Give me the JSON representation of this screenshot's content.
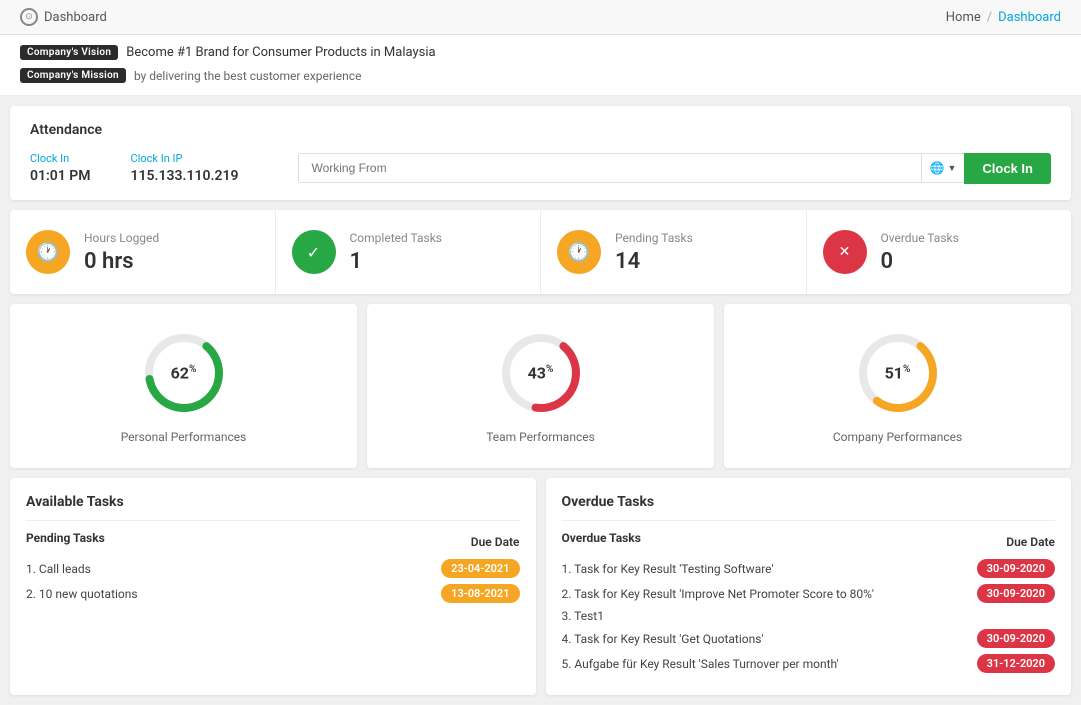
{
  "topbar": {
    "title": "Dashboard",
    "home_label": "Home",
    "separator": "/",
    "current_label": "Dashboard"
  },
  "banner": {
    "vision_badge": "Company's Vision",
    "vision_text": "Become #1 Brand for Consumer Products in Malaysia",
    "mission_badge": "Company's Mission",
    "mission_text": "by delivering the best customer experience"
  },
  "attendance": {
    "title": "Attendance",
    "clock_in_label": "Clock In",
    "clock_in_value": "01:01 PM",
    "clock_in_ip_label": "Clock In IP",
    "clock_in_ip_value": "115.133.110.219",
    "working_from_placeholder": "Working From",
    "clock_in_btn": "Clock In"
  },
  "stats": [
    {
      "icon": "clock",
      "icon_class": "yellow",
      "label": "Hours Logged",
      "count": "0 hrs"
    },
    {
      "icon": "check",
      "icon_class": "green",
      "label": "Completed Tasks",
      "count": "1"
    },
    {
      "icon": "clock",
      "icon_class": "yellow2",
      "label": "Pending Tasks",
      "count": "14"
    },
    {
      "icon": "x",
      "icon_class": "red",
      "label": "Overdue Tasks",
      "count": "0"
    }
  ],
  "performances": [
    {
      "label": "Personal Performances",
      "percent": 62,
      "color_start": "#28a745",
      "color_end": "#28a745",
      "bg": "#e8e8e8",
      "text_color": "#28a745"
    },
    {
      "label": "Team Performances",
      "percent": 43,
      "color_start": "#dc3545",
      "color_end": "#dc3545",
      "bg": "#e8e8e8",
      "text_color": "#dc3545"
    },
    {
      "label": "Company Performances",
      "percent": 51,
      "color_start": "#f5a623",
      "color_end": "#f5a623",
      "bg": "#e8e8e8",
      "text_color": "#f5a623"
    }
  ],
  "available_tasks": {
    "title": "Available Tasks",
    "subtitle": "Pending Tasks",
    "due_date_label": "Due Date",
    "tasks": [
      {
        "name": "1. Call leads",
        "due_date": "23-04-2021",
        "badge_color": "yellow"
      },
      {
        "name": "2. 10 new quotations",
        "due_date": "13-08-2021",
        "badge_color": "yellow"
      }
    ]
  },
  "overdue_tasks": {
    "title": "Overdue Tasks",
    "subtitle": "Overdue Tasks",
    "due_date_label": "Due Date",
    "tasks": [
      {
        "name": "1. Task for Key Result 'Testing Software'",
        "due_date": "30-09-2020",
        "badge_color": "red"
      },
      {
        "name": "2. Task for Key Result 'Improve Net Promoter Score to 80%'",
        "due_date": "30-09-2020",
        "badge_color": "red"
      },
      {
        "name": "3. Test1",
        "due_date": "",
        "badge_color": ""
      },
      {
        "name": "4. Task for Key Result 'Get Quotations'",
        "due_date": "30-09-2020",
        "badge_color": "red"
      },
      {
        "name": "5. Aufgabe für Key Result 'Sales Turnover per month'",
        "due_date": "31-12-2020",
        "badge_color": "red"
      }
    ]
  }
}
